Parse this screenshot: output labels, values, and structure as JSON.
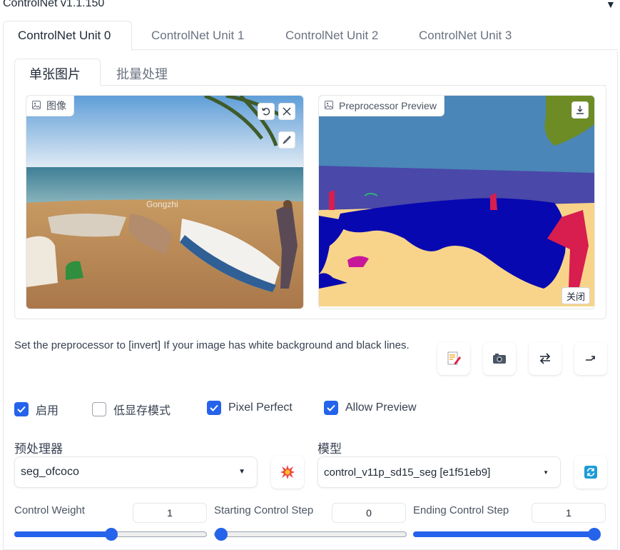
{
  "header": {
    "title": "ControlNet v1.1.150"
  },
  "unit_tabs": [
    "ControlNet Unit 0",
    "ControlNet Unit 1",
    "ControlNet Unit 2",
    "ControlNet Unit 3"
  ],
  "sub_tabs": [
    "单张图片",
    "批量处理"
  ],
  "image_panel": {
    "label": "图像",
    "watermark": "Gongzhi"
  },
  "preview_panel": {
    "label": "Preprocessor Preview",
    "close_label": "关闭"
  },
  "hint_text": "Set the preprocessor to [invert] If your image has white background and black lines.",
  "checkboxes": [
    {
      "label": "启用",
      "checked": true
    },
    {
      "label": "低显存模式",
      "checked": false
    },
    {
      "label": "Pixel Perfect",
      "checked": true
    },
    {
      "label": "Allow Preview",
      "checked": true
    }
  ],
  "preprocessor": {
    "label": "预处理器",
    "value": "seg_ofcoco"
  },
  "model": {
    "label": "模型",
    "value": "control_v11p_sd15_seg [e1f51eb9]"
  },
  "sliders": [
    {
      "label": "Control Weight",
      "value": "1",
      "fraction": 0.5
    },
    {
      "label": "Starting Control Step",
      "value": "0",
      "fraction": 0.0
    },
    {
      "label": "Ending Control Step",
      "value": "1",
      "fraction": 1.0
    }
  ],
  "colors": {
    "accent": "#2563eb"
  }
}
